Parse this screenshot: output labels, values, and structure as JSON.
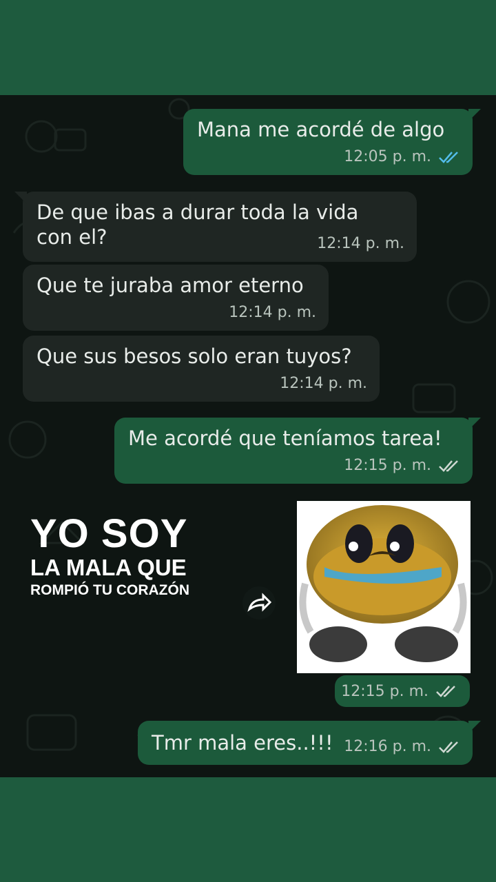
{
  "messages": [
    {
      "text": "Mana me acordé de algo",
      "time": "12:05 p. m."
    },
    {
      "text_line1": "De que ibas a durar toda la vida",
      "text_line2": "con el?",
      "time": "12:14 p. m."
    },
    {
      "text": "Que te juraba amor eterno",
      "time": "12:14 p. m."
    },
    {
      "text": "Que sus besos solo eran tuyos?",
      "time": "12:14 p. m."
    },
    {
      "text": "Me acordé que teníamos tarea!",
      "time": "12:15 p. m."
    },
    {
      "time": "12:15 p. m."
    },
    {
      "text": "Tmr mala eres..!!!",
      "time": "12:16 p. m."
    }
  ],
  "sticker": {
    "line1": "YO SOY",
    "line2": "LA MALA QUE",
    "line3": "ROMPIÓ TU CORAZÓN"
  },
  "colors": {
    "frame_background": "#1e5b3e",
    "chat_background": "#0e1512",
    "outgoing_bubble": "#1c5a3b",
    "incoming_bubble": "#1f2623",
    "read_ticks": "#53bdeb"
  },
  "icons": [
    "double-check-icon",
    "forward-icon",
    "crying-emoji-sticker"
  ]
}
